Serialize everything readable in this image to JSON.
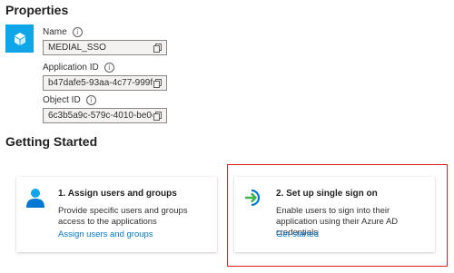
{
  "properties": {
    "title": "Properties",
    "fields": [
      {
        "label": "Name",
        "value": "MEDIAL_SSO"
      },
      {
        "label": "Application ID",
        "value": "b47dafe5-93aa-4c77-999f-3..."
      },
      {
        "label": "Object ID",
        "value": "6c3b5a9c-579c-4010-be0c-..."
      }
    ]
  },
  "getting_started": {
    "title": "Getting Started",
    "cards": [
      {
        "title": "1. Assign users and groups",
        "description": "Provide specific users and groups access to the applications",
        "link": "Assign users and groups",
        "icon": "user-icon"
      },
      {
        "title": "2. Set up single sign on",
        "description": "Enable users to sign into their application using their Azure AD credentials",
        "link": "Get started",
        "icon": "sign-in-arrow-icon"
      }
    ]
  },
  "colors": {
    "app_icon_bg": "#0ea5e9",
    "link": "#0078d4",
    "highlight_border": "#e02020"
  }
}
